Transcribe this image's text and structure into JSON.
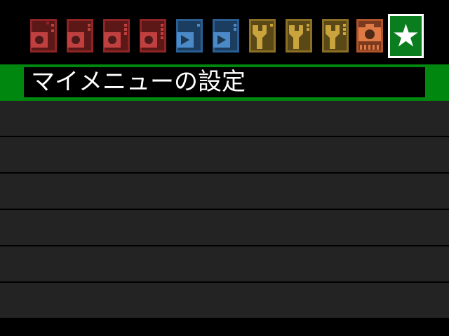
{
  "tabs": [
    {
      "icon": "shooting-camera-icon",
      "color": "#8e2424",
      "page": 1,
      "active": false
    },
    {
      "icon": "shooting-camera-icon",
      "color": "#8e2424",
      "page": 2,
      "active": false
    },
    {
      "icon": "shooting-camera-icon",
      "color": "#8e2424",
      "page": 3,
      "active": false
    },
    {
      "icon": "shooting-camera-icon",
      "color": "#8e2424",
      "page": 4,
      "active": false
    },
    {
      "icon": "playback-icon",
      "color": "#2a5f94",
      "page": 1,
      "active": false
    },
    {
      "icon": "playback-icon",
      "color": "#2a5f94",
      "page": 2,
      "active": false
    },
    {
      "icon": "setup-wrench-icon",
      "color": "#8a6f24",
      "page": 1,
      "active": false
    },
    {
      "icon": "setup-wrench-icon",
      "color": "#8a6f24",
      "page": 2,
      "active": false
    },
    {
      "icon": "setup-wrench-icon",
      "color": "#8a6f24",
      "page": 3,
      "active": false
    },
    {
      "icon": "custom-function-camera-icon",
      "color": "#b0542a",
      "active": false
    },
    {
      "icon": "my-menu-star-icon",
      "color": "#0a7d1e",
      "active": true
    }
  ],
  "header": {
    "title": "マイメニューの設定",
    "band_color": "#00870f"
  },
  "menu": {
    "rows": [
      "",
      "",
      "",
      "",
      "",
      ""
    ]
  }
}
